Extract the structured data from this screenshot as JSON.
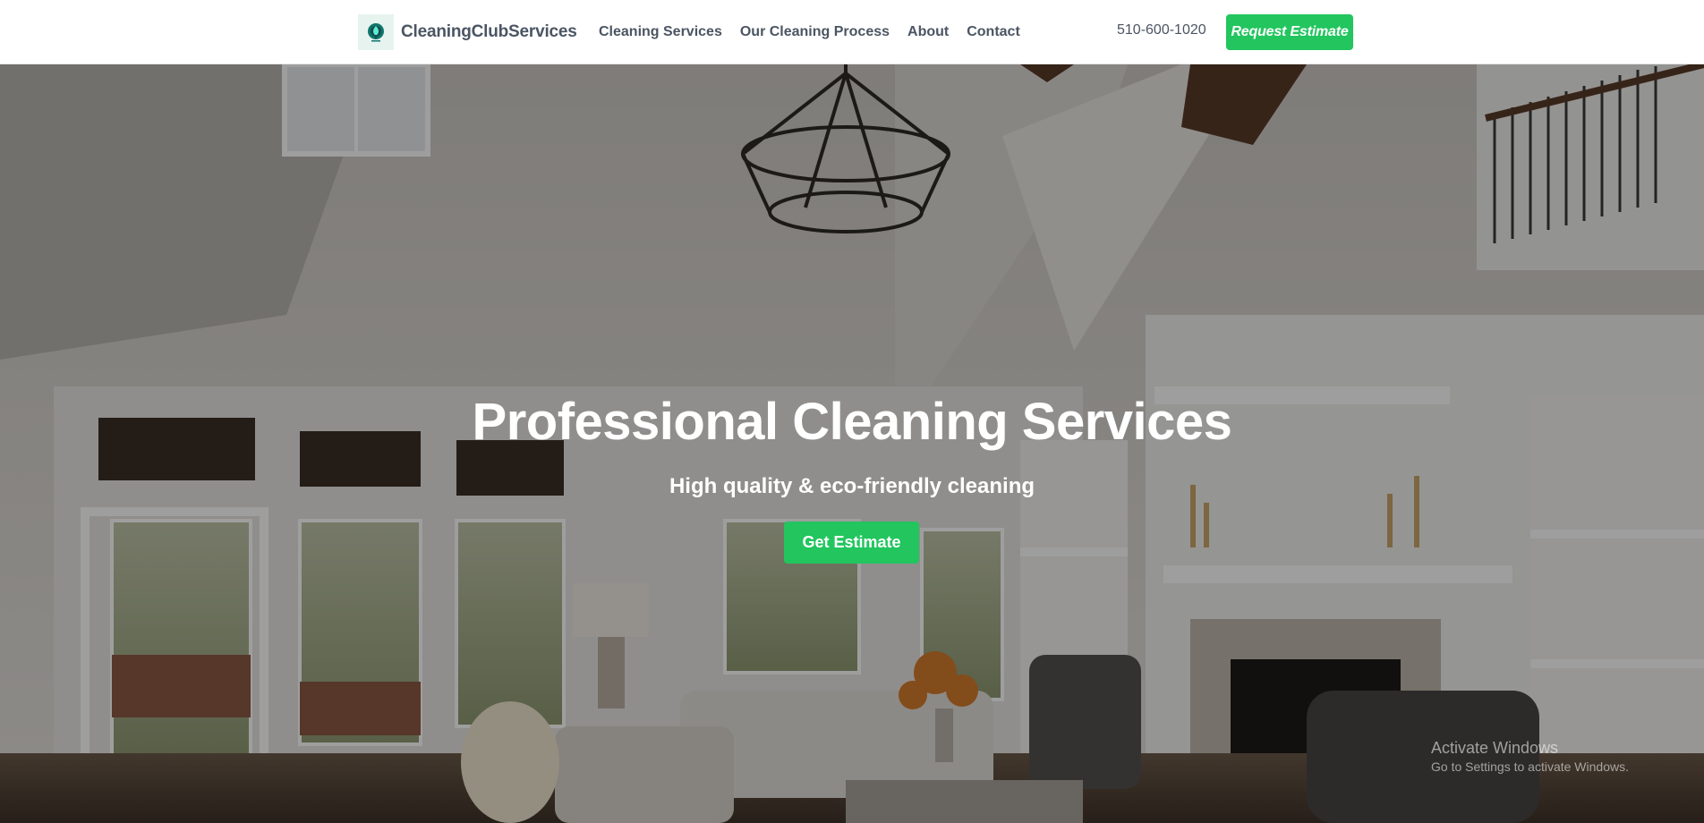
{
  "header": {
    "brand_name": "CleaningClubServices",
    "logo_icon": "tree-leaf-icon",
    "nav": [
      {
        "label": "Cleaning Services"
      },
      {
        "label": "Our Cleaning Process"
      },
      {
        "label": "About"
      },
      {
        "label": "Contact"
      }
    ],
    "phone": "510-600-1020",
    "cta_label": "Request Estimate"
  },
  "hero": {
    "title": "Professional Cleaning Services",
    "subtitle": "High quality & eco-friendly cleaning",
    "button_label": "Get Estimate",
    "background": "living-room-photo"
  },
  "watermark": {
    "title": "Activate Windows",
    "subtitle": "Go to Settings to activate Windows."
  },
  "colors": {
    "accent": "#22c55e",
    "nav_text": "#4b5563",
    "logo_bg": "#e7f3ee"
  }
}
